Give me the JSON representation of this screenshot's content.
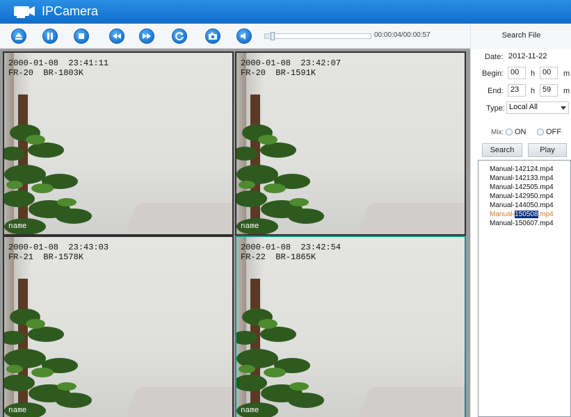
{
  "app": {
    "title": "IPCamera"
  },
  "toolbar": {
    "buttons": [
      "eject-icon",
      "pause-icon",
      "stop-icon",
      "rewind-icon",
      "fast-forward-icon",
      "refresh-icon",
      "snapshot-icon",
      "volume-icon"
    ],
    "time": "00:00:04/00:00:57",
    "progress": 0.07
  },
  "search_panel": {
    "header": "Search File",
    "date_label": "Date:",
    "date_value": "2012-11-22",
    "begin_label": "Begin:",
    "begin_hour": "00",
    "begin_min": "00",
    "end_label": "End:",
    "end_hour": "23",
    "end_min": "59",
    "h_unit": "h",
    "m_unit": "m",
    "type_label": "Type:",
    "type_value": "Local All",
    "mix_label": "Mix:",
    "mix_on": "ON",
    "mix_off": "OFF",
    "search_button": "Search",
    "play_button": "Play",
    "files": [
      "Manual-142124.mp4",
      "Manual-142133.mp4",
      "Manual-142505.mp4",
      "Manual-142950.mp4",
      "Manual-144050.mp4",
      "Manual-150508.mp4",
      "Manual-150607.mp4"
    ],
    "selected_file": {
      "prefix": "Manual-",
      "highlight": "150508",
      "suffix": ".mp4"
    }
  },
  "tiles": [
    {
      "timestamp": "2000-01-08  23:41:11",
      "info": "FR-20  BR-1803K",
      "name": "name"
    },
    {
      "timestamp": "2000-01-08  23:42:07",
      "info": "FR-20  BR-1591K",
      "name": "name"
    },
    {
      "timestamp": "2000-01-08  23:43:03",
      "info": "FR-21  BR-1578K",
      "name": "name"
    },
    {
      "timestamp": "2000-01-08  23:42:54",
      "info": "FR-22  BR-1865K",
      "name": "name"
    }
  ],
  "colors": {
    "titlebar": "#1a7fd8",
    "button": "#1976d2",
    "selected_tile_border": "#1f8c86",
    "selected_file": "#d97a1c"
  }
}
